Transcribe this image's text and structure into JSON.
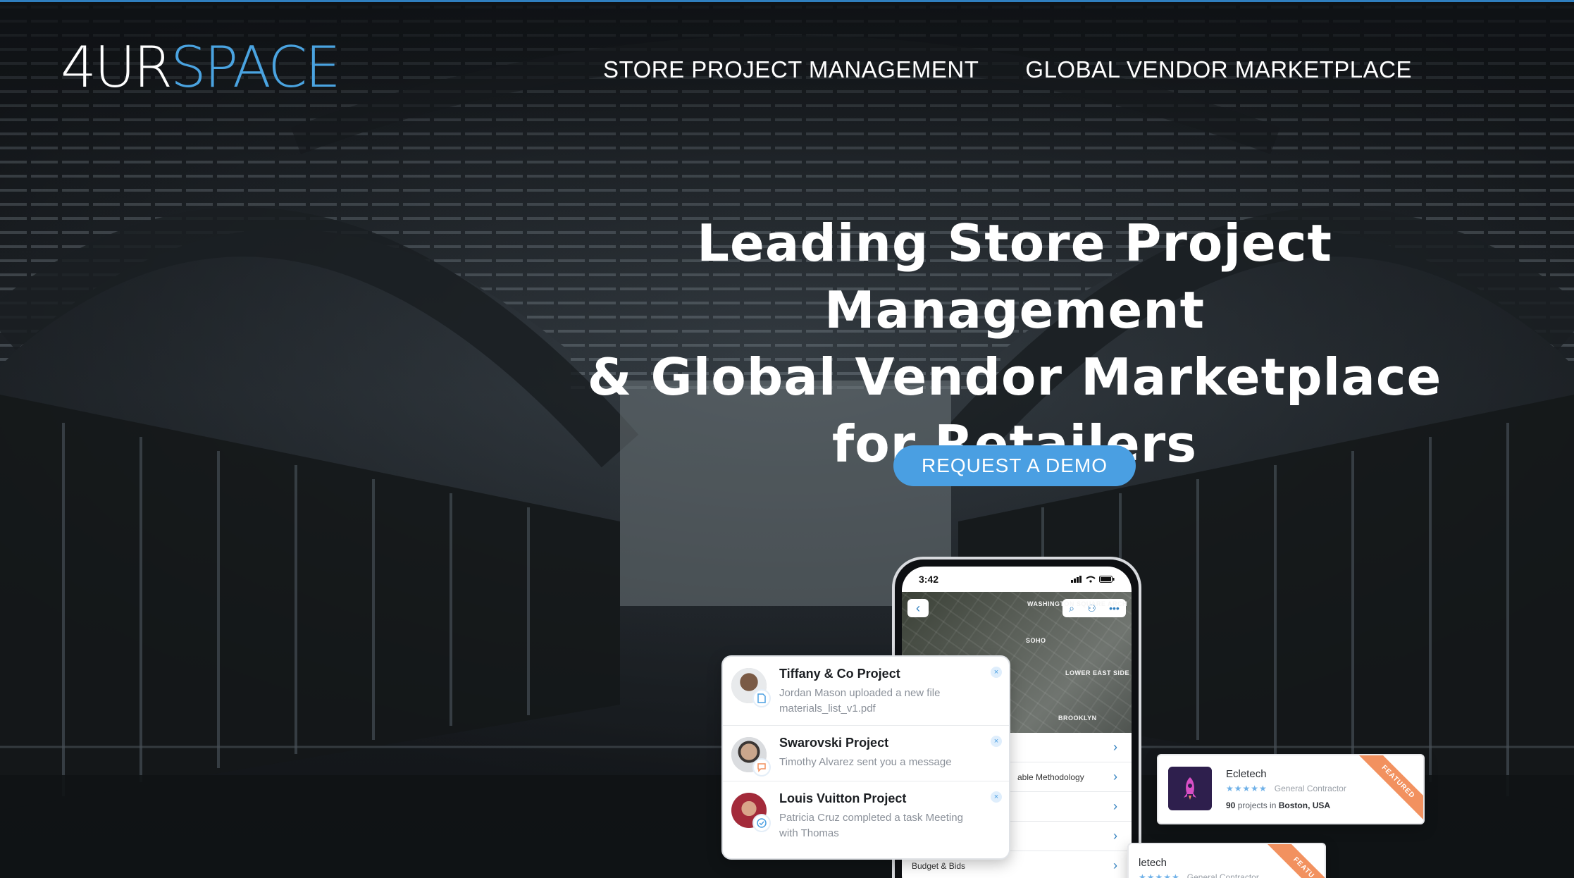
{
  "brand": {
    "logo_part1": "4UR",
    "logo_part2": "SPACE",
    "accent_color": "#4aa3e0"
  },
  "nav": {
    "items": [
      "STORE PROJECT MANAGEMENT",
      "GLOBAL VENDOR MARKETPLACE"
    ]
  },
  "hero": {
    "title_line1": "Leading Store Project Management",
    "title_line2": "& Global Vendor Marketplace",
    "title_line3": "for Retailers",
    "cta_label": "REQUEST A DEMO",
    "cta_color": "#4a9fe2"
  },
  "phone": {
    "time": "3:42",
    "map_labels": [
      "WASHINGTON SQUARE ARCH",
      "SOHO",
      "LOWER EAST SIDE",
      "BROOKLYN"
    ],
    "menu_items": [
      "",
      "able Methodology",
      "",
      "",
      "Budget & Bids"
    ]
  },
  "notifications": [
    {
      "title": "Tiffany & Co Project",
      "body_line1": "Jordan Mason uploaded a new file",
      "body_line2": "materials_list_v1.pdf",
      "badge_icon": "file-icon"
    },
    {
      "title": "Swarovski Project",
      "body_line1": "Timothy Alvarez sent you a message",
      "body_line2": "",
      "badge_icon": "chat-icon"
    },
    {
      "title": "Louis Vuitton Project",
      "body_line1": "Patricia Cruz completed a task Meeting",
      "body_line2": "with Thomas",
      "badge_icon": "check-icon"
    }
  ],
  "vendors": [
    {
      "name": "Ecletech",
      "stars": "★★★★★",
      "category": "General Contractor",
      "projects_count": "90",
      "projects_text": "projects in",
      "location": "Boston, USA",
      "ribbon": "FEATURED"
    },
    {
      "name": "letech",
      "stars": "★★★★★",
      "category": "General Contractor",
      "ribbon": "FEATU"
    }
  ]
}
